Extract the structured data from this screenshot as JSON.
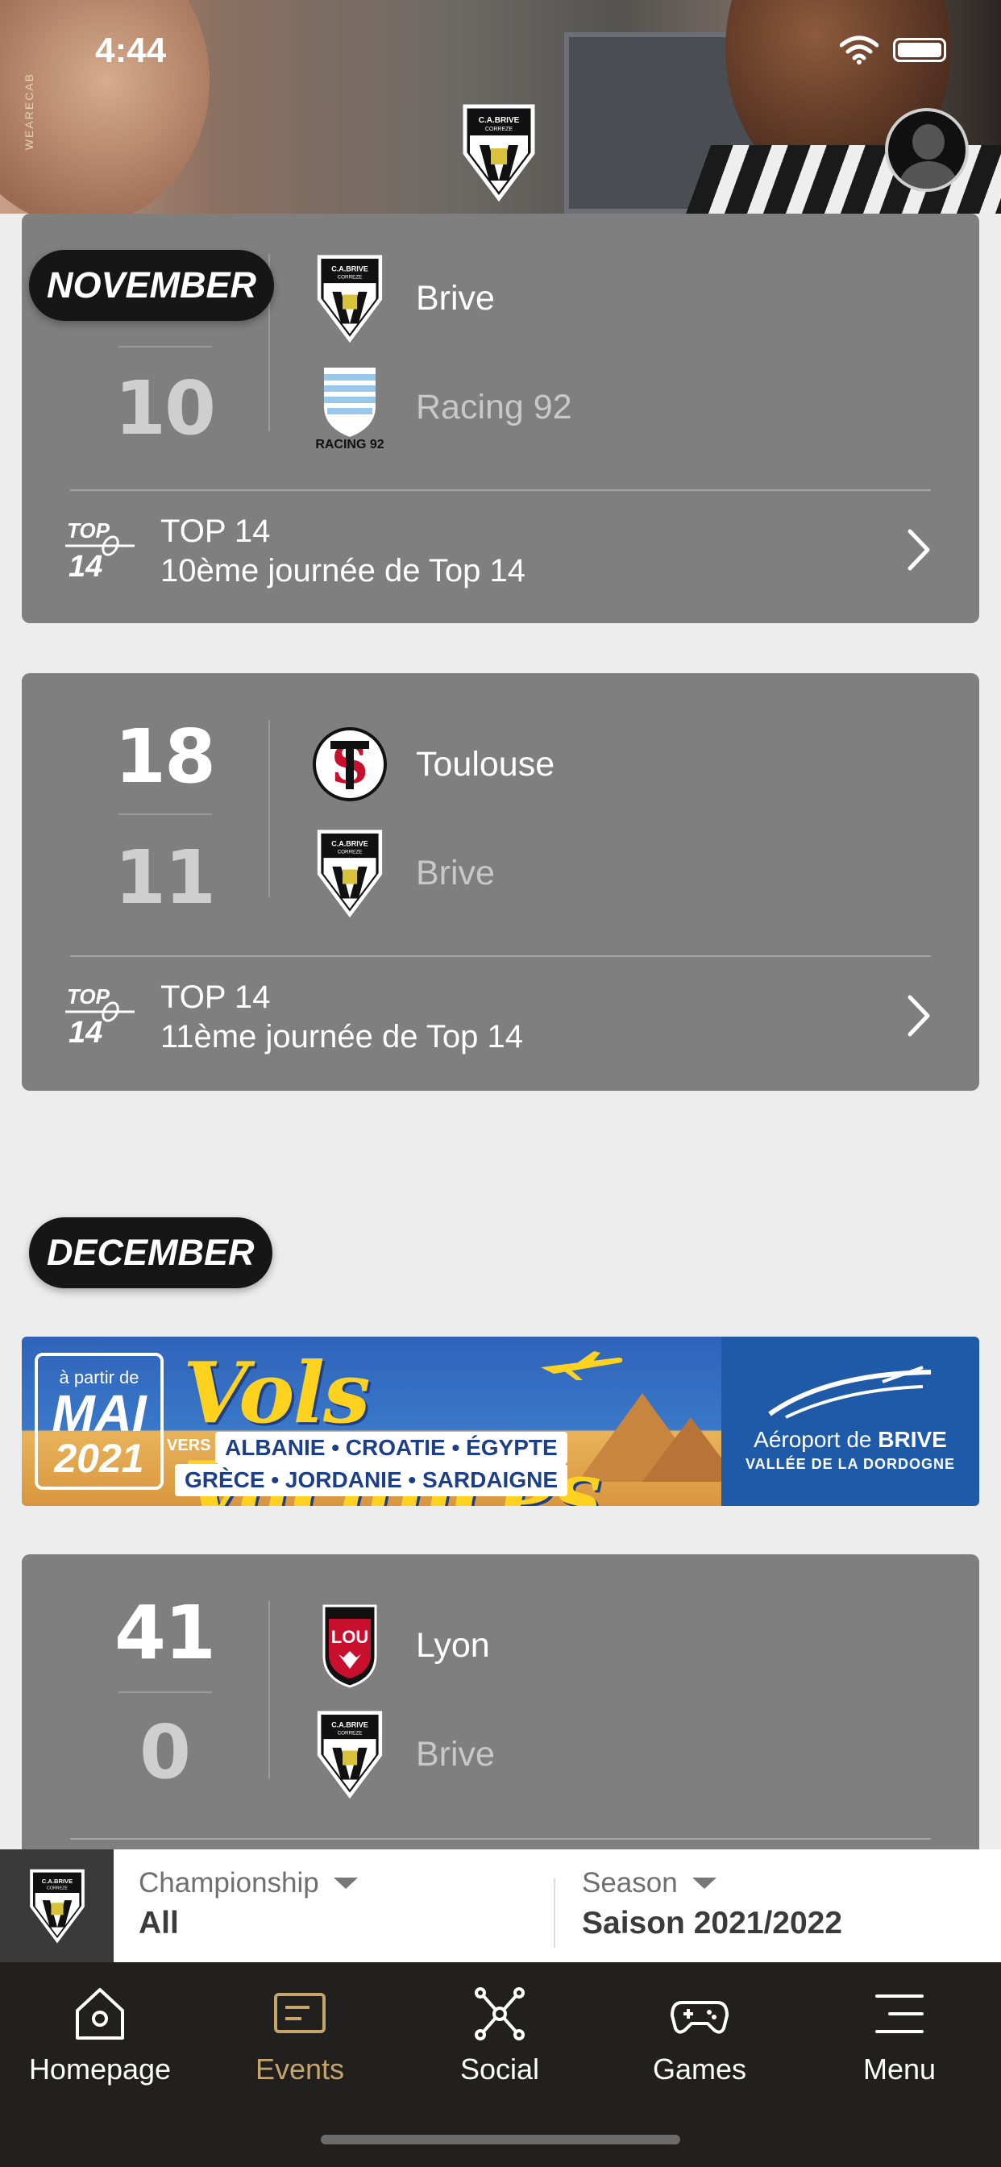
{
  "status_bar": {
    "time": "4:44"
  },
  "header": {
    "side_text": "WEARECAB"
  },
  "months": [
    {
      "label": "NOVEMBER"
    },
    {
      "label": "DECEMBER"
    }
  ],
  "matches": [
    {
      "score_top": "",
      "score_bottom": "10",
      "home_team": "Brive",
      "away_team": "Racing 92",
      "competition": "TOP 14",
      "round": "10ème journée de Top 14"
    },
    {
      "score_top": "18",
      "score_bottom": "11",
      "home_team": "Toulouse",
      "away_team": "Brive",
      "competition": "TOP 14",
      "round": "11ème journée de Top 14"
    },
    {
      "score_top": "41",
      "score_bottom": "0",
      "home_team": "Lyon",
      "away_team": "Brive"
    }
  ],
  "ad": {
    "date_small": "à partir de",
    "date_month": "MAI",
    "date_year": "2021",
    "title": "Vols Vacances",
    "vers": "VERS",
    "destinations_1": "ALBANIE • CROATIE • ÉGYPTE",
    "destinations_2": "GRÈCE • JORDANIE • SARDAIGNE",
    "airport_prefix": "Aéroport de ",
    "airport_name": "BRIVE",
    "region": "VALLÉE DE LA DORDOGNE"
  },
  "filter": {
    "championship_label": "Championship",
    "championship_value": "All",
    "season_label": "Season",
    "season_value": "Saison 2021/2022"
  },
  "tabs": [
    {
      "label": "Homepage",
      "icon": "home-icon",
      "active": false
    },
    {
      "label": "Events",
      "icon": "events-icon",
      "active": true
    },
    {
      "label": "Social",
      "icon": "social-icon",
      "active": false
    },
    {
      "label": "Games",
      "icon": "gamepad-icon",
      "active": false
    },
    {
      "label": "Menu",
      "icon": "menu-icon",
      "active": false
    }
  ],
  "colors": {
    "card_bg": "#7f7f7f",
    "page_bg": "#ededed",
    "tabbar_bg": "#221f1f",
    "active_tab": "#c6a56c"
  }
}
